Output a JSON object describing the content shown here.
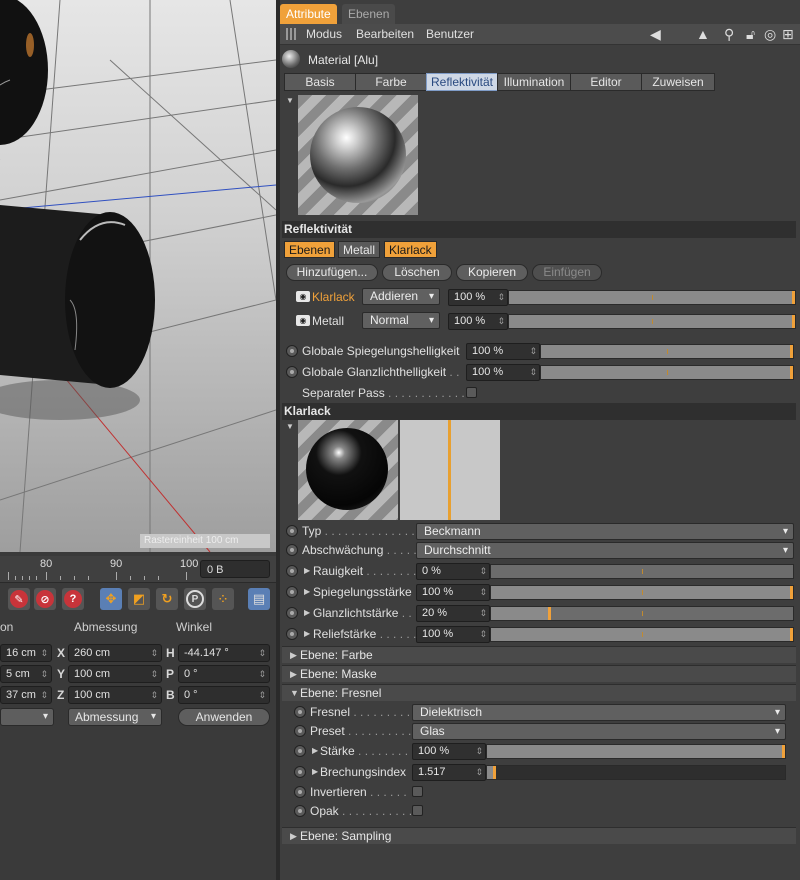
{
  "viewport": {
    "status": "Rastereinheit 100 cm"
  },
  "timeline": {
    "ticks": [
      "80",
      "90",
      "100"
    ],
    "frame": "0 B"
  },
  "coords": {
    "headers": [
      "on",
      "Abmessung",
      "Winkel"
    ],
    "rows": [
      {
        "pos": "16 cm",
        "axis1": "X",
        "size": "260 cm",
        "axis2": "H",
        "angle": "-44.147 °"
      },
      {
        "pos": "5 cm",
        "axis1": "Y",
        "size": "100 cm",
        "axis2": "P",
        "angle": "0 °"
      },
      {
        "pos": "37 cm",
        "axis1": "Z",
        "size": "100 cm",
        "axis2": "B",
        "angle": "0 °"
      }
    ],
    "mode_drop": "",
    "size_drop": "Abmessung",
    "apply_button": "Anwenden"
  },
  "panel": {
    "top_tabs": [
      "Attribute",
      "Ebenen"
    ],
    "menu": [
      "Modus",
      "Bearbeiten",
      "Benutzer"
    ],
    "material_title": "Material [Alu]",
    "mat_tabs": [
      "Basis",
      "Farbe",
      "Reflektivität",
      "Illumination",
      "Editor",
      "Zuweisen"
    ],
    "reflect_header": "Reflektivität",
    "layer_tabs": [
      "Ebenen",
      "Metall",
      "Klarlack"
    ],
    "buttons": [
      "Hinzufügen...",
      "Löschen",
      "Kopieren",
      "Einfügen"
    ],
    "layers": [
      {
        "name": "Klarlack",
        "mode": "Addieren",
        "value": "100 %",
        "fill": 1.0
      },
      {
        "name": "Metall",
        "mode": "Normal",
        "value": "100 %",
        "fill": 1.0
      }
    ],
    "global": [
      {
        "label": "Globale Spiegelungshelligkeit",
        "value": "100 %",
        "fill": 1.0
      },
      {
        "label": "Globale Glanzlichthelligkeit",
        "value": "100 %",
        "fill": 1.0
      }
    ],
    "separate_pass": "Separater Pass",
    "klarlack_header": "Klarlack",
    "typ_label": "Typ",
    "typ_value": "Beckmann",
    "abschw_label": "Abschwächung",
    "abschw_value": "Durchschnitt",
    "params": [
      {
        "label": "Rauigkeit",
        "value": "0 %",
        "fill": 0.0
      },
      {
        "label": "Spiegelungsstärke",
        "value": "100 %",
        "fill": 1.0
      },
      {
        "label": "Glanzlichtstärke",
        "value": "20 %",
        "fill": 0.2
      },
      {
        "label": "Reliefstärke",
        "value": "100 %",
        "fill": 1.0
      }
    ],
    "groups": [
      "Ebene: Farbe",
      "Ebene: Maske",
      "Ebene: Fresnel",
      "Ebene: Sampling"
    ],
    "fresnel_label": "Fresnel",
    "fresnel_value": "Dielektrisch",
    "preset_label": "Preset",
    "preset_value": "Glas",
    "staerke_label": "Stärke",
    "staerke_value": "100 %",
    "staerke_fill": 1.0,
    "brech_label": "Brechungsindex",
    "brech_value": "1.517",
    "brech_fill": 0.03,
    "invert_label": "Invertieren",
    "opak_label": "Opak"
  }
}
